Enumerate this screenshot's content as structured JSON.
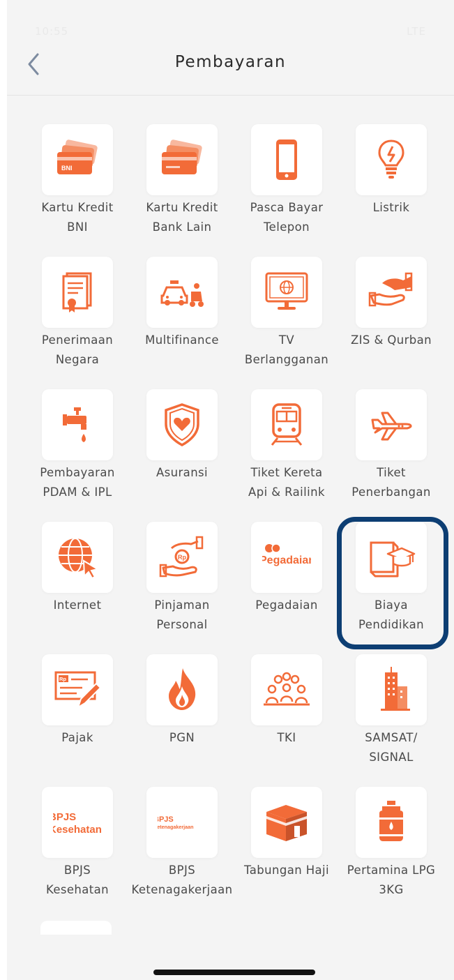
{
  "status_bar": {
    "time": "10:55",
    "indicators": "LTE"
  },
  "header": {
    "title": "Pembayaran",
    "back_icon": "chevron-left-icon"
  },
  "accent_color": "#f26b38",
  "highlight_color": "#0d3e73",
  "tiles": [
    {
      "label": "Kartu Kredit\nBNI",
      "icon": "credit-card-bni-icon"
    },
    {
      "label": "Kartu Kredit\nBank Lain",
      "icon": "credit-card-icon"
    },
    {
      "label": "Pasca Bayar\nTelepon",
      "icon": "phone-icon"
    },
    {
      "label": "Listrik",
      "icon": "lightbulb-icon"
    },
    {
      "label": "Penerimaan\nNegara",
      "icon": "certificate-icon"
    },
    {
      "label": "Multifinance",
      "icon": "car-motorbike-icon"
    },
    {
      "label": "TV\nBerlangganan",
      "icon": "tv-icon"
    },
    {
      "label": "ZIS & Qurban",
      "icon": "giving-hand-icon"
    },
    {
      "label": "Pembayaran\nPDAM & IPL",
      "icon": "water-tap-icon"
    },
    {
      "label": "Asuransi",
      "icon": "shield-heart-icon"
    },
    {
      "label": "Tiket Kereta\nApi & Railink",
      "icon": "train-icon"
    },
    {
      "label": "Tiket\nPenerbangan",
      "icon": "airplane-icon"
    },
    {
      "label": "Internet",
      "icon": "globe-cursor-icon"
    },
    {
      "label": "Pinjaman\nPersonal",
      "icon": "hand-money-icon"
    },
    {
      "label": "Pegadaian",
      "icon": "pegadaian-logo-icon",
      "logo_text": "Pegadaian"
    },
    {
      "label": "Biaya\nPendidikan",
      "icon": "book-graduation-icon"
    },
    {
      "label": "Pajak",
      "icon": "tax-form-pen-icon"
    },
    {
      "label": "PGN",
      "icon": "flame-icon"
    },
    {
      "label": "TKI",
      "icon": "people-group-icon"
    },
    {
      "label": "SAMSAT/\nSIGNAL",
      "icon": "building-icon"
    },
    {
      "label": "BPJS\nKesehatan",
      "icon": "bpjs-kesehatan-logo-icon",
      "logo_line1": "BPJS",
      "logo_line2": "Kesehatan"
    },
    {
      "label": "BPJS\nKetenagakerjaan",
      "icon": "bpjs-ketenagakerjaan-logo-icon",
      "logo_line1": "BPJS",
      "logo_line2": "Ketenagakerjaan"
    },
    {
      "label": "Tabungan Haji",
      "icon": "kaaba-icon"
    },
    {
      "label": "Pertamina LPG\n3KG",
      "icon": "gas-cylinder-icon"
    }
  ]
}
